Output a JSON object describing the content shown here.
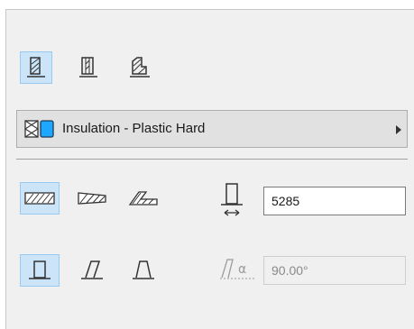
{
  "colors": {
    "panel_bg": "#f0f0f0",
    "selected_bg": "#cce4f7",
    "selected_border": "#99c9ef",
    "icon_stroke": "#333333",
    "disabled_text": "#8a8a8a",
    "insulation_swatch": "#1ea7ff"
  },
  "toolbar_top": {
    "buttons": [
      {
        "icon": "wall-outline-icon",
        "selected": true
      },
      {
        "icon": "wall-core-icon",
        "selected": false
      },
      {
        "icon": "wall-profile-icon",
        "selected": false
      }
    ]
  },
  "material": {
    "label": "Insulation - Plastic Hard",
    "icon": "insulation-material-icon",
    "arrow": "submenu-arrow-icon"
  },
  "structure_row": {
    "buttons": [
      {
        "icon": "wall-straight-icon",
        "selected": true
      },
      {
        "icon": "wall-trapezoid-icon",
        "selected": false
      },
      {
        "icon": "wall-polygon-icon",
        "selected": false
      }
    ],
    "thickness_icon": "wall-thickness-icon",
    "thickness_value": "5285"
  },
  "geometry_row": {
    "buttons": [
      {
        "icon": "wall-vertical-icon",
        "selected": true
      },
      {
        "icon": "wall-slanted-icon",
        "selected": false
      },
      {
        "icon": "wall-double-slanted-icon",
        "selected": false
      }
    ],
    "angle_icon": "slant-angle-icon",
    "angle_value": "90.00°"
  }
}
